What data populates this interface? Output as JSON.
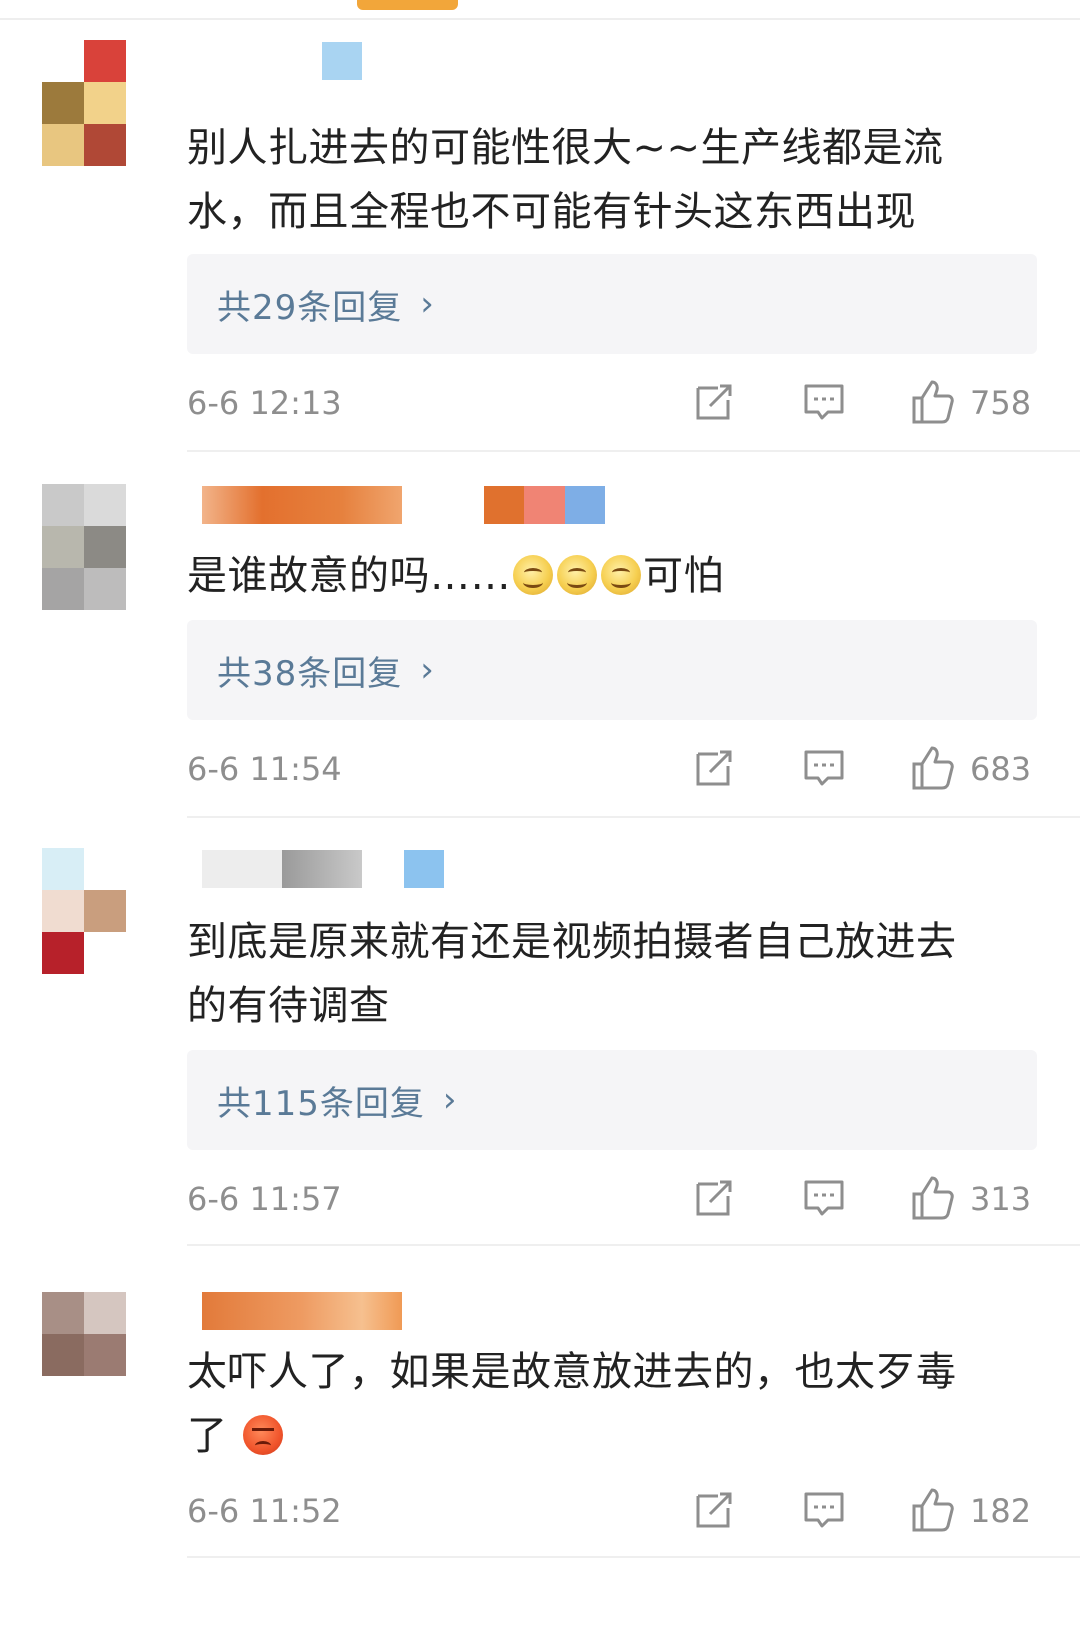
{
  "colors": {
    "accent_indicator": "#f2a63a",
    "reply_link": "#5a7a97",
    "meta_text": "#8e8e8e",
    "body_text": "#222222"
  },
  "comments": [
    {
      "text_lines": [
        "别人扎进去的可能性很大~~生产线都是流",
        "水，而且全程也不可能有针头这东西出现"
      ],
      "reply_label": "共29条回复",
      "timestamp": "6-6 12:13",
      "likes": "758"
    },
    {
      "text_lines": [
        "是谁故意的吗……",
        "可怕"
      ],
      "emojis": [
        "smile-emoji",
        "smile-emoji",
        "smile-emoji"
      ],
      "reply_label": "共38条回复",
      "timestamp": "6-6 11:54",
      "likes": "683"
    },
    {
      "text_lines": [
        "到底是原来就有还是视频拍摄者自己放进去",
        "的有待调查"
      ],
      "reply_label": "共115条回复",
      "timestamp": "6-6 11:57",
      "likes": "313"
    },
    {
      "text_lines": [
        "太吓人了，如果是故意放进去的，也太歹毒",
        "了"
      ],
      "emojis": [
        "angry-emoji"
      ],
      "timestamp": "6-6 11:52",
      "likes": "182"
    }
  ],
  "icons": {
    "repost": "repost-icon",
    "comment": "comment-icon",
    "like": "thumbs-up-icon",
    "chevron": "chevron-right-icon",
    "chevron_glyph": "›"
  }
}
